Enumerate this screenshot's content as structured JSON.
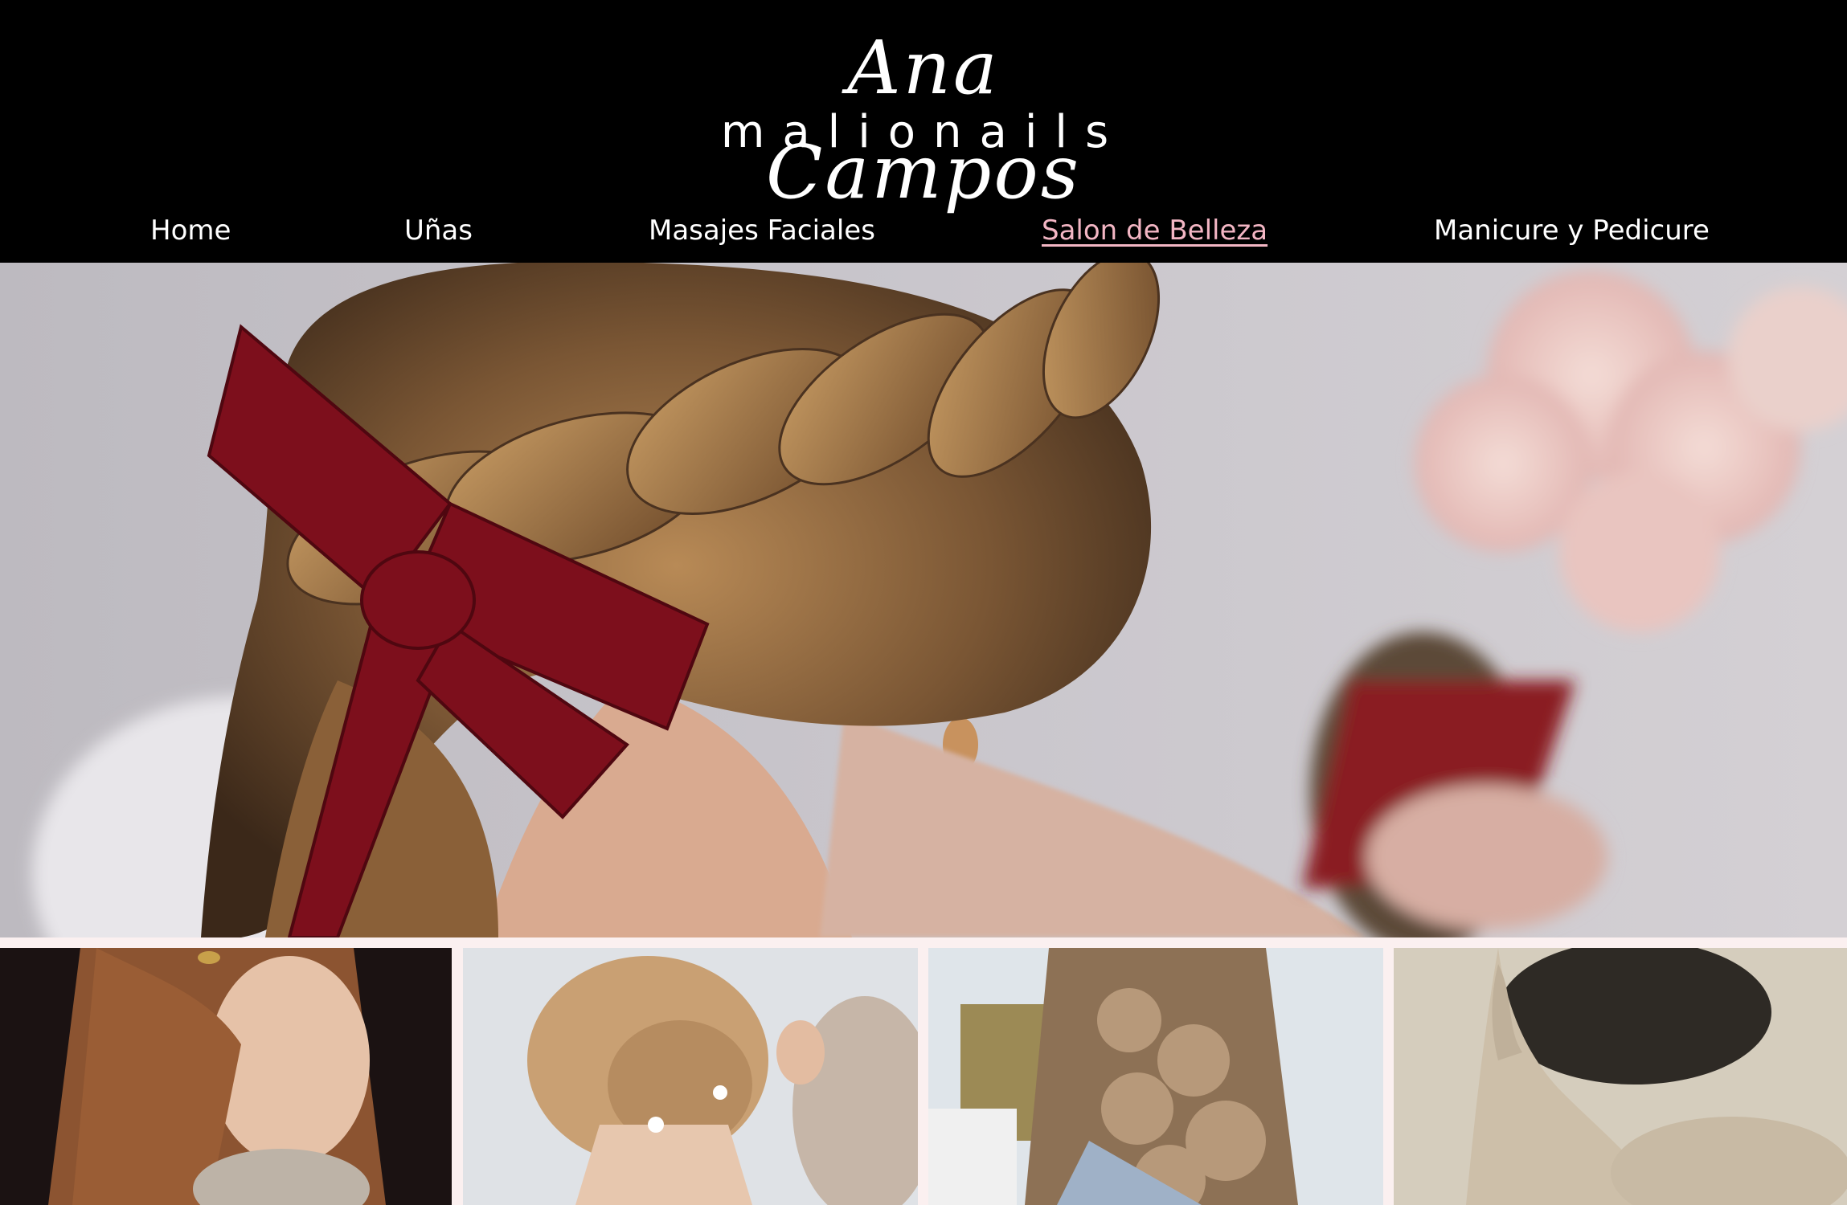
{
  "brand": {
    "script_name": "Ana Campos",
    "sub_name": "malionails"
  },
  "nav": {
    "items": [
      {
        "label": "Home"
      },
      {
        "label": "Uñas"
      },
      {
        "label": "Masajes Faciales"
      },
      {
        "label": "Salon de Belleza"
      },
      {
        "label": "Manicure y Pedicure"
      }
    ],
    "active_index": 3,
    "active_color": "#f3b6c4"
  },
  "colors": {
    "header_bg": "#000000",
    "page_bg": "#fbf0f0",
    "ribbon": "#7d0f1c"
  }
}
